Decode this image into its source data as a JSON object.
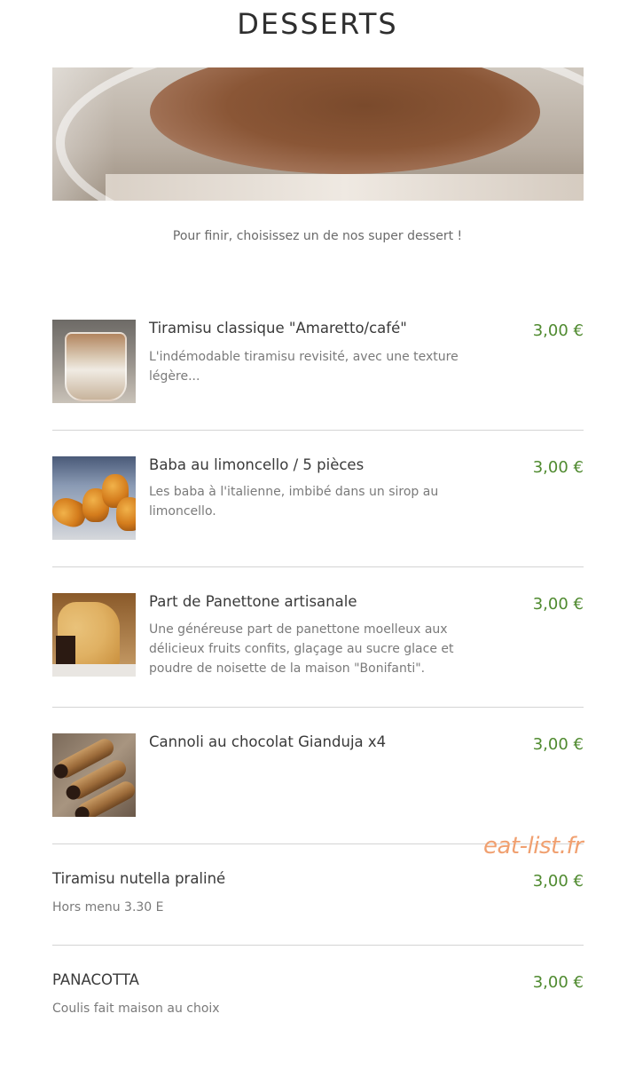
{
  "page": {
    "title": "DESSERTS",
    "intro": "Pour finir, choisissez un de nos super dessert !",
    "watermark": "eat-list.fr"
  },
  "items": [
    {
      "name": "Tiramisu classique \"Amaretto/café\"",
      "description": "L'indémodable tiramisu revisité, avec une texture légère...",
      "price": "3,00 €",
      "image": "tiramisu-cup-photo"
    },
    {
      "name": "Baba au limoncello / 5 pièces",
      "description": "Les baba à l'italienne, imbibé dans un sirop au limoncello.",
      "price": "3,00 €",
      "image": "baba-photo"
    },
    {
      "name": "Part de Panettone artisanale",
      "description": "Une généreuse part de panettone moelleux aux délicieux fruits confits, glaçage au sucre glace et poudre de noisette de la maison \"Bonifanti\".",
      "price": "3,00 €",
      "image": "panettone-photo"
    },
    {
      "name": "Cannoli au chocolat Gianduja x4",
      "description": "",
      "price": "3,00 €",
      "image": "cannoli-photo"
    },
    {
      "name": "Tiramisu nutella praliné",
      "description": "Hors menu 3.30 E",
      "price": "3,00 €"
    },
    {
      "name": "PANACOTTA",
      "description": "Coulis fait maison au choix",
      "price": "3,00 €"
    }
  ],
  "colors": {
    "price": "#4f8a2f",
    "watermark": "#f0a070",
    "divider": "#d4d4d4"
  }
}
